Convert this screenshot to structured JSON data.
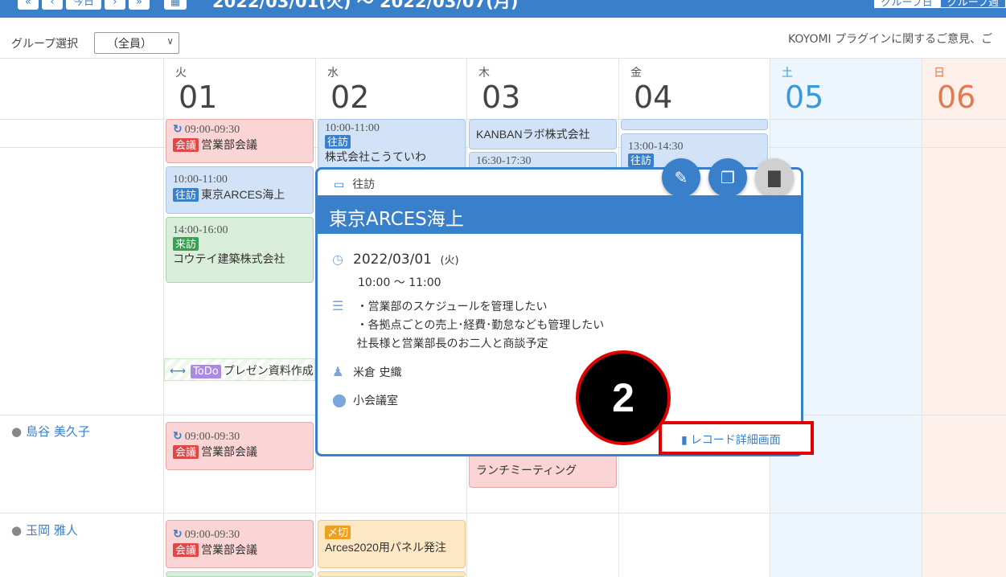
{
  "topbar": {
    "nav_first": "«",
    "nav_prev": "‹",
    "nav_today": "今日",
    "nav_next": "›",
    "nav_last": "»",
    "calendar_icon": "calendar-icon",
    "date_range": "2022/03/01(火) ～ 2022/03/07(月)",
    "view_tab_1": "グループ日",
    "view_tab_2": "グループ週"
  },
  "toolbar": {
    "group_label": "グループ選択",
    "group_value": "（全員）",
    "feedback_text": "KOYOMI プラグインに関するご意見、ご"
  },
  "days": [
    {
      "dow": "火",
      "num": "01"
    },
    {
      "dow": "水",
      "num": "02"
    },
    {
      "dow": "木",
      "num": "03"
    },
    {
      "dow": "金",
      "num": "04"
    },
    {
      "dow": "土",
      "num": "05"
    },
    {
      "dow": "日",
      "num": "06"
    }
  ],
  "events": {
    "e1_time": "09:00-09:30",
    "e1_tag": "会議",
    "e1_title": "営業部会議",
    "e2_time": "10:00-11:00",
    "e2_tag": "往訪",
    "e2_title": "東京ARCES海上",
    "e3_time": "14:00-16:00",
    "e3_tag": "来訪",
    "e3_title": "コウテイ建築株式会社",
    "e4_time": "10:00-11:00",
    "e4_tag": "往訪",
    "e4_title": "株式会社こうていわ",
    "e5_title": "KANBANラボ株式会社",
    "e6_time": "16:30-17:30",
    "e7_time": "13:00-14:30",
    "e7_tag": "往訪",
    "todo_tag": "ToDo",
    "todo_title": "プレゼン資料作成",
    "e8_time": "09:00-09:30",
    "e8_tag": "会議",
    "e8_title": "営業部会議",
    "e9_title": "ランチミーティング",
    "e10_time": "09:00-09:30",
    "e10_tag": "会議",
    "e10_title": "営業部会議",
    "e11_tag": "〆切",
    "e11_title": "Arces2020用パネル発注"
  },
  "people": [
    "島谷 美久子",
    "玉岡 雅人"
  ],
  "popup": {
    "type": "往訪",
    "title": "東京ARCES海上",
    "date": "2022/03/01",
    "weekday": "(火)",
    "time": "10:00 ～ 11:00",
    "note_line1": "・営業部のスケジュールを管理したい",
    "note_line2": "・各拠点ごとの売上･経費･勤怠なども管理したい",
    "note_line3": "社長様と営業部長のお二人と商談予定",
    "attendee": "米倉 史織",
    "location": "小会議室",
    "detail_button": "レコード詳細画面"
  },
  "callout_number": "2",
  "colors": {
    "accent": "#3a7fc9",
    "highlight": "#e00000",
    "saturday": "#3a9ad9",
    "sunday": "#e07a50"
  }
}
